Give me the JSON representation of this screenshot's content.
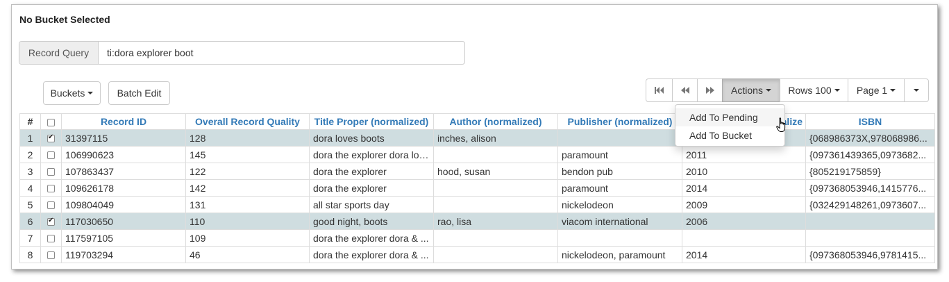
{
  "header": {
    "bucket_status": "No Bucket Selected"
  },
  "query": {
    "label": "Record Query",
    "value": "ti:dora explorer boot"
  },
  "toolbar": {
    "buckets_label": "Buckets",
    "batch_edit_label": "Batch Edit",
    "actions_label": "Actions",
    "rows_label": "Rows 100",
    "page_label": "Page 1"
  },
  "actions_menu": {
    "items": [
      "Add To Pending",
      "Add To Bucket"
    ]
  },
  "table": {
    "headers": [
      "#",
      "",
      "Record ID",
      "Overall Record Quality",
      "Title Proper (normalized)",
      "Author (normalized)",
      "Publisher (normalized)",
      "nalize",
      "ISBN"
    ],
    "rows": [
      {
        "n": "1",
        "checked": true,
        "id": "31397115",
        "quality": "128",
        "title": "dora loves boots",
        "author": "inches, alison",
        "publisher": "",
        "date": "",
        "isbn": "{068986373X,978068986..."
      },
      {
        "n": "2",
        "checked": false,
        "id": "106990623",
        "quality": "145",
        "title": "dora the explorer dora lov...",
        "author": "",
        "publisher": "paramount",
        "date": "2011",
        "isbn": "{097361439365,0973682..."
      },
      {
        "n": "3",
        "checked": false,
        "id": "107863437",
        "quality": "122",
        "title": "dora the explorer",
        "author": "hood, susan",
        "publisher": "bendon pub",
        "date": "2010",
        "isbn": "{805219175859}"
      },
      {
        "n": "4",
        "checked": false,
        "id": "109626178",
        "quality": "142",
        "title": "dora the explorer",
        "author": "",
        "publisher": "paramount",
        "date": "2014",
        "isbn": "{097368053946,1415776..."
      },
      {
        "n": "5",
        "checked": false,
        "id": "109804049",
        "quality": "131",
        "title": "all star sports day",
        "author": "",
        "publisher": "nickelodeon",
        "date": "2009",
        "isbn": "{032429148261,0973607..."
      },
      {
        "n": "6",
        "checked": true,
        "id": "117030650",
        "quality": "110",
        "title": "good night, boots",
        "author": "rao, lisa",
        "publisher": "viacom international",
        "date": "2006",
        "isbn": ""
      },
      {
        "n": "7",
        "checked": false,
        "id": "117597105",
        "quality": "109",
        "title": "dora the explorer dora & ...",
        "author": "",
        "publisher": "",
        "date": "",
        "isbn": ""
      },
      {
        "n": "8",
        "checked": false,
        "id": "119703294",
        "quality": "46",
        "title": "dora the explorer dora & ...",
        "author": "",
        "publisher": "nickelodeon, paramount",
        "date": "2014",
        "isbn": "{097368053946,9781415..."
      }
    ]
  },
  "colors": {
    "header_text": "#337ab7",
    "selected_row": "#cfdde0",
    "active_button": "#d4d4d4"
  }
}
